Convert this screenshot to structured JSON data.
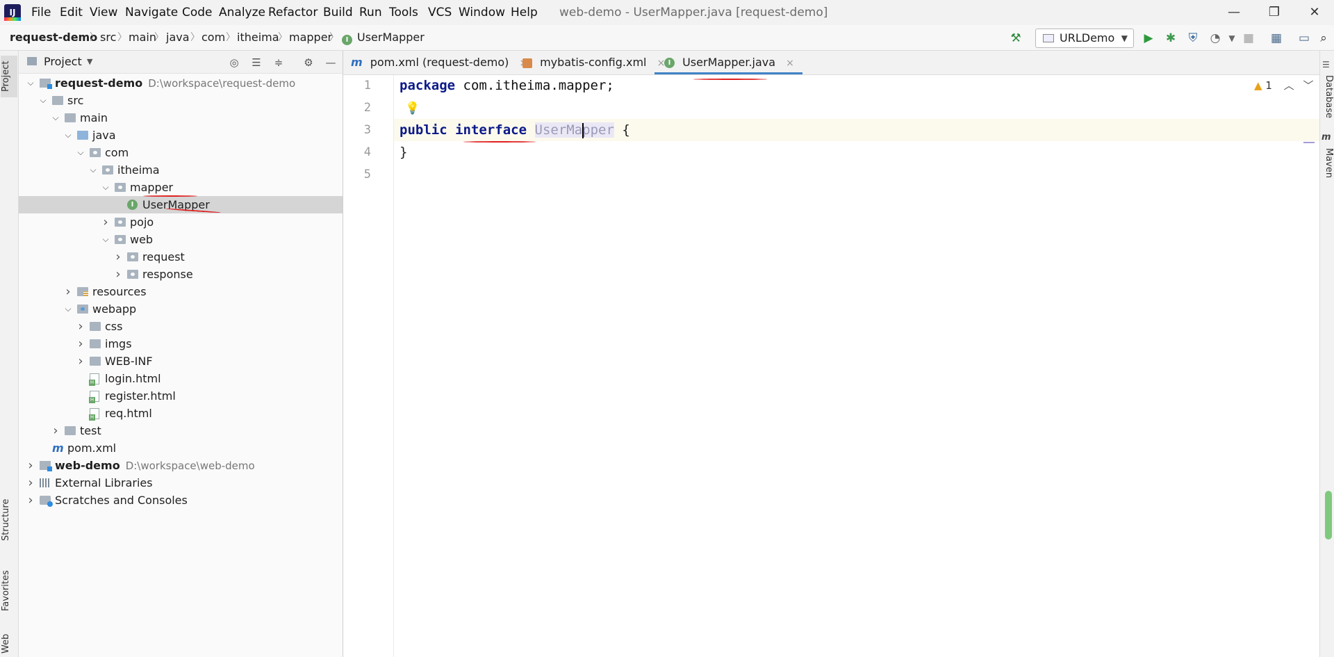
{
  "menu": {
    "logo": "IJ",
    "items": [
      "File",
      "Edit",
      "View",
      "Navigate",
      "Code",
      "Analyze",
      "Refactor",
      "Build",
      "Run",
      "Tools",
      "VCS",
      "Window",
      "Help"
    ],
    "window_title": "web-demo - UserMapper.java [request-demo]",
    "controls": {
      "minimize": "—",
      "restore": "❐",
      "close": "✕"
    }
  },
  "breadcrumb": [
    "request-demo",
    "src",
    "main",
    "java",
    "com",
    "itheima",
    "mapper",
    "UserMapper"
  ],
  "breadcrumb_sep": "〉",
  "toolbar": {
    "run_config": "URLDemo",
    "icons": [
      "hammer-icon",
      "run-icon",
      "debug-icon",
      "coverage-icon",
      "profile-icon",
      "stop-icon",
      "project-structure-icon",
      "terminal-icon",
      "search-icon"
    ]
  },
  "left_stripe": {
    "project": "Project",
    "structure": "Structure",
    "favorites": "Favorites",
    "web": "Web"
  },
  "project_panel": {
    "title": "Project",
    "tree": [
      {
        "label": "request-demo",
        "extra": "D:\\workspace\\request-demo",
        "level": 0,
        "state": "open",
        "icon": "module",
        "bold": true
      },
      {
        "label": "src",
        "level": 1,
        "state": "open",
        "icon": "folder"
      },
      {
        "label": "main",
        "level": 2,
        "state": "open",
        "icon": "folder"
      },
      {
        "label": "java",
        "level": 3,
        "state": "open",
        "icon": "src"
      },
      {
        "label": "com",
        "level": 4,
        "state": "open",
        "icon": "pkg"
      },
      {
        "label": "itheima",
        "level": 5,
        "state": "open",
        "icon": "pkg"
      },
      {
        "label": "mapper",
        "level": 6,
        "state": "open",
        "icon": "pkg"
      },
      {
        "label": "UserMapper",
        "level": 7,
        "state": "none",
        "icon": "interface",
        "selected": true
      },
      {
        "label": "pojo",
        "level": 6,
        "state": "closed",
        "icon": "pkg"
      },
      {
        "label": "web",
        "level": 6,
        "state": "open",
        "icon": "pkg"
      },
      {
        "label": "request",
        "level": 7,
        "state": "closed",
        "icon": "pkg"
      },
      {
        "label": "response",
        "level": 7,
        "state": "closed",
        "icon": "pkg"
      },
      {
        "label": "resources",
        "level": 3,
        "state": "closed",
        "icon": "res"
      },
      {
        "label": "webapp",
        "level": 3,
        "state": "open",
        "icon": "web"
      },
      {
        "label": "css",
        "level": 4,
        "state": "closed",
        "icon": "folder"
      },
      {
        "label": "imgs",
        "level": 4,
        "state": "closed",
        "icon": "folder"
      },
      {
        "label": "WEB-INF",
        "level": 4,
        "state": "closed",
        "icon": "folder"
      },
      {
        "label": "login.html",
        "level": 4,
        "state": "none",
        "icon": "html"
      },
      {
        "label": "register.html",
        "level": 4,
        "state": "none",
        "icon": "html"
      },
      {
        "label": "req.html",
        "level": 4,
        "state": "none",
        "icon": "html"
      },
      {
        "label": "test",
        "level": 2,
        "state": "closed",
        "icon": "folder"
      },
      {
        "label": "pom.xml",
        "level": 1,
        "state": "none",
        "icon": "maven"
      },
      {
        "label": "web-demo",
        "extra": "D:\\workspace\\web-demo",
        "level": 0,
        "state": "closed",
        "icon": "module",
        "bold": true
      },
      {
        "label": "External Libraries",
        "level": 0,
        "state": "closed",
        "icon": "lib"
      },
      {
        "label": "Scratches and Consoles",
        "level": 0,
        "state": "closed",
        "icon": "scratch"
      }
    ]
  },
  "editor": {
    "tabs": [
      {
        "label": "pom.xml (request-demo)",
        "icon": "m"
      },
      {
        "label": "mybatis-config.xml",
        "icon": "xml"
      },
      {
        "label": "UserMapper.java",
        "icon": "I",
        "active": true
      }
    ],
    "close_glyph": "×",
    "line_numbers": [
      "1",
      "2",
      "3",
      "4",
      "5"
    ],
    "code": {
      "line1_kw": "package",
      "line1_rest": " com.itheima.mapper;",
      "line3_kw1": "public",
      "line3_kw2": "interface",
      "line3_cls": "UserMapper",
      "line3_rest": " {",
      "line4": "}"
    },
    "warning_count": "1"
  },
  "right_stripe": {
    "database": "Database",
    "maven": "Maven"
  },
  "colors": {
    "accent": "#4083c9",
    "keyword": "#0c1a8a",
    "annotation_red": "#e02020",
    "interface_icon": "#6aa66a"
  }
}
